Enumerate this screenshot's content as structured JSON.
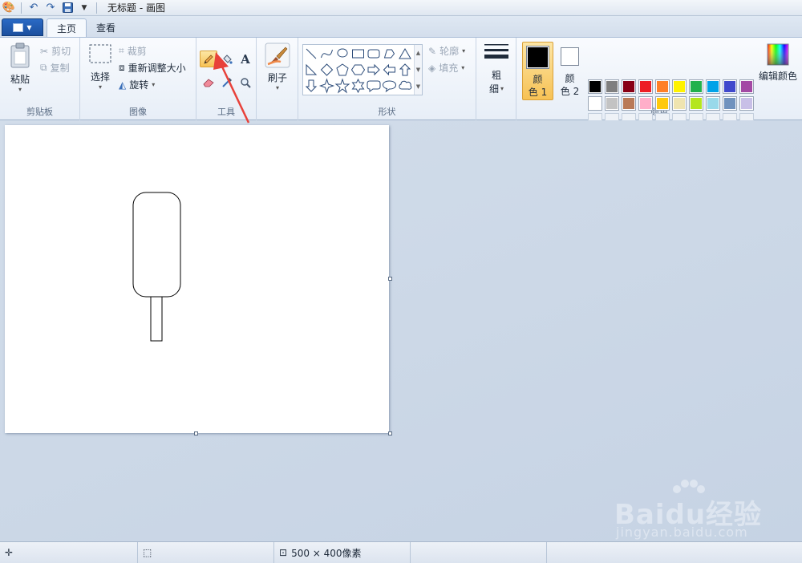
{
  "window": {
    "title": "无标题 - 画图"
  },
  "quick_access": {
    "icons": [
      "paint-app-icon",
      "undo-icon",
      "redo-icon",
      "save-icon",
      "customize-dropdown-icon"
    ]
  },
  "tabs": [
    {
      "label": "主页",
      "active": true
    },
    {
      "label": "查看",
      "active": false
    }
  ],
  "ribbon": {
    "clipboard": {
      "label": "剪贴板",
      "paste": "粘贴",
      "cut": "剪切",
      "copy": "复制"
    },
    "image": {
      "label": "图像",
      "select": "选择",
      "crop": "裁剪",
      "resize": "重新调整大小",
      "rotate": "旋转"
    },
    "tools": {
      "label": "工具",
      "active_tool": "pencil"
    },
    "brushes": {
      "label": "刷子"
    },
    "shapes": {
      "label": "形状",
      "outline": "轮廓",
      "fill": "填充"
    },
    "size": {
      "label_top": "粗",
      "label_bottom": "细"
    },
    "colors": {
      "label": "颜色",
      "color1_top": "颜",
      "color1_bottom": "色 1",
      "color2_top": "颜",
      "color2_bottom": "色 2",
      "color1_value": "#000000",
      "color2_value": "#ffffff",
      "edit": "编辑颜色",
      "palette_row1": [
        "#000000",
        "#7f7f7f",
        "#880015",
        "#ed1c24",
        "#ff7f27",
        "#fff200",
        "#22b14c",
        "#00a2e8",
        "#3f48cc",
        "#a349a4"
      ],
      "palette_row2": [
        "#ffffff",
        "#c3c3c3",
        "#b97a57",
        "#ffaec9",
        "#ffc90e",
        "#efe4b0",
        "#b5e61d",
        "#99d9ea",
        "#7092be",
        "#c8bfe7"
      ]
    }
  },
  "canvas": {
    "background": "#ffffff"
  },
  "status_bar": {
    "image_size": "500 × 400像素"
  },
  "watermark": {
    "brand": "Baidu经验",
    "url": "jingyan.baidu.com"
  }
}
